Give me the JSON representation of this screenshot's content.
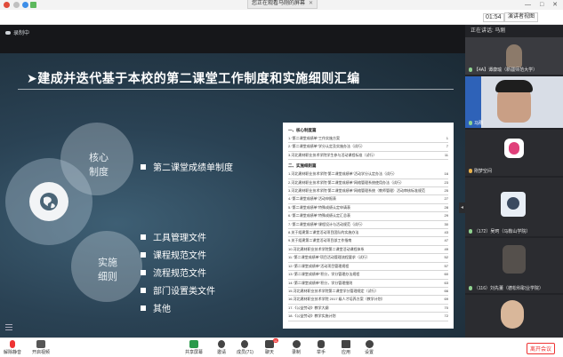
{
  "topbar": {
    "share_banner": "您正在观看马刚的屏幕",
    "window_controls": "— □ ✕"
  },
  "toolbar": {
    "timer": "01:54",
    "view_button": "演讲者视图"
  },
  "stage": {
    "recording_label": "录制中"
  },
  "slide": {
    "title": "➤建成并迭代基于本校的第二课堂工作制度和实施细则汇编",
    "core_label": "核心\n制度",
    "impl_label": "实施\n细则",
    "core_items": [
      "第二课堂成绩单制度"
    ],
    "impl_items": [
      "工具管理文件",
      "课程规范文件",
      "流程规范文件",
      "部门设置类文件",
      "其他"
    ]
  },
  "document": {
    "section1": "一、核心制度篇",
    "rows1": [
      {
        "text": "1.“第二课堂成绩单”工作实施方案",
        "page": "1"
      },
      {
        "text": "2.“第二课堂成绩单”学分认定及实施办法（试行）",
        "page": "7"
      },
      {
        "text": "3.河北建材职业技术学院学生参与活动课程标准（试行）",
        "page": "11"
      }
    ],
    "section2": "二、实施细则篇",
    "rows2": [
      {
        "text": "1.河北建材职业技术学院“第二课堂成绩单”活动学分认定办法（试行）",
        "page": "16"
      },
      {
        "text": "2.河北建材职业技术学院“第二课堂成绩单”网络管理系统使用办法（试行）",
        "page": "23"
      },
      {
        "text": "3.河北建材职业技术学院“第二课堂成绩单”网络管理系统（教师管理）活动审核标准规范",
        "page": "25"
      },
      {
        "text": "4.“第二课堂成绩单”活动申报表",
        "page": "27"
      },
      {
        "text": "5.“第二课堂成绩单”特殊成绩认定申请表",
        "page": "28"
      },
      {
        "text": "6.“第二课堂成绩单”特殊成绩认定汇总表",
        "page": "29"
      },
      {
        "text": "7.“第二课堂成绩单”课程设计与活动规范（试行）",
        "page": "30"
      },
      {
        "text": "8.关于组建第二课堂活动项目团队的实施办法",
        "page": "43"
      },
      {
        "text": "9.关于组建第二课堂活动项目部工作指南",
        "page": "47"
      },
      {
        "text": "10.河北建材职业技术学院第二课堂活动课程体系",
        "page": "49"
      },
      {
        "text": "11.“第二课堂成绩单”项目活动管理流程要求（试行）",
        "page": "52"
      },
      {
        "text": "12.“第二课堂成绩单”活动项目管理规程",
        "page": "57"
      },
      {
        "text": "13.“第二课堂成绩单”积分，学分管理办法规程",
        "page": "60"
      },
      {
        "text": "14.“第二课堂成绩单”积分，学分管理细则",
        "page": "63"
      },
      {
        "text": "15.河北建材职业技术学院第二课堂学分管理规定（试行）",
        "page": "66"
      },
      {
        "text": "16.河北建材职业技术学院 2017 级人才培养方案（教学计划）",
        "page": "69"
      },
      {
        "text": "17.《公益劳动》教学大纲",
        "page": "70"
      },
      {
        "text": "18.《公益劳动》教学实施计划",
        "page": "72"
      }
    ]
  },
  "panel": {
    "header": "正在讲话: 马刚",
    "participants": [
      {
        "name": "【4A】谭康瑜（新疆师范大学）"
      },
      {
        "name": "马刚"
      },
      {
        "name": "刚梦空间"
      },
      {
        "name": "（172）吴珂（马鞍山学院）"
      },
      {
        "name": "（116）刘先董（德松科职业学院）"
      }
    ]
  },
  "bottombar": {
    "items": [
      "解除静音",
      "开启视频",
      "共享屏幕",
      "邀请",
      "成员(71)",
      "聊天",
      "录制",
      "举手",
      "应用",
      "设置"
    ],
    "chat_badge": "11",
    "leave": "离开会议"
  },
  "colors": {
    "slide_bg": "#2a4254",
    "panel_bg": "#222327",
    "leave_red": "#e33333"
  }
}
